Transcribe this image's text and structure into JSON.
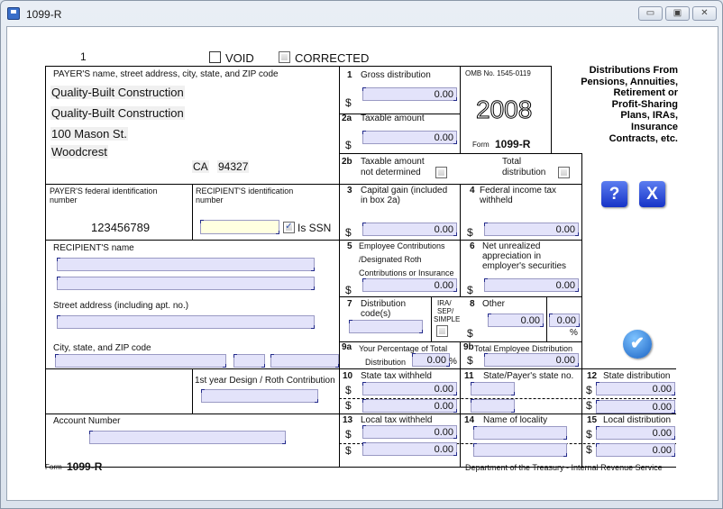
{
  "window": {
    "title": "1099-R",
    "min_label": "▭",
    "max_label": "▣",
    "close_label": "✕"
  },
  "form": {
    "sequence": "1",
    "void_label": "VOID",
    "corrected_label": "CORRECTED",
    "payer": {
      "label": "PAYER'S name, street address, city, state, and ZIP code",
      "name1": "Quality-Built Construction",
      "name2": "Quality-Built Construction",
      "street": "100 Mason St.",
      "city": "Woodcrest",
      "state": "CA",
      "zip": "94327"
    },
    "payer_fed_id": {
      "label1": "PAYER'S federal identification",
      "label2": "number",
      "value": "123456789"
    },
    "recipient_id": {
      "label1": "RECIPIENT'S identification",
      "label2": "number",
      "value": "",
      "is_ssn_label": "Is SSN",
      "is_ssn": true
    },
    "recipient": {
      "name_label": "RECIPIENT'S   name",
      "name1": "",
      "name2": "",
      "street_label": "Street address (including apt. no.)",
      "street": "",
      "city_label": "City, state, and ZIP code",
      "city": "",
      "state": "",
      "zip": ""
    },
    "first_year": {
      "label": "1st year Design / Roth Contribution",
      "value": ""
    },
    "account": {
      "label": "Account Number",
      "value": ""
    },
    "omb": "OMB No. 1545-0119",
    "year": "2008",
    "form_prefix": "Form",
    "form_name": "1099-R",
    "heading": [
      "Distributions From",
      "Pensions, Annuities,",
      "Retirement or",
      "Profit-Sharing",
      "Plans, IRAs,",
      "Insurance",
      "Contracts, etc."
    ],
    "box1": {
      "num": "1",
      "label": "Gross distribution",
      "value": "0.00"
    },
    "box2a": {
      "num": "2a",
      "label": "Taxable amount",
      "value": "0.00"
    },
    "box2b": {
      "num": "2b",
      "label1": "Taxable amount",
      "label2": "not determined",
      "total_label1": "Total",
      "total_label2": "distribution"
    },
    "box3": {
      "num": "3",
      "label1": "Capital gain (included",
      "label2": "in box 2a)",
      "value": "0.00"
    },
    "box4": {
      "num": "4",
      "label1": "Federal income tax",
      "label2": "withheld",
      "value": "0.00"
    },
    "box5": {
      "num": "5",
      "label1": "Employee Contributions",
      "label2": "/Designated Roth",
      "label3": "Contributions or Insurance",
      "value": "0.00"
    },
    "box6": {
      "num": "6",
      "label1": "Net unrealized",
      "label2": "appreciation in",
      "label3": "employer's securities",
      "value": "0.00"
    },
    "box7": {
      "num": "7",
      "label1": "Distribution",
      "label2": "code(s)",
      "value": "",
      "ira1": "IRA/",
      "ira2": "SEP/",
      "ira3": "SIMPLE"
    },
    "box8": {
      "num": "8",
      "label": "Other",
      "value": "0.00",
      "pct_value": "0.00",
      "pct_sign": "%"
    },
    "box9a": {
      "num": "9a",
      "label1": "Your Percentage of Total",
      "label2": "Distribution",
      "value": "0.00",
      "pct_sign": "%"
    },
    "box9b": {
      "num": "9b",
      "label": "Total Employee Distribution",
      "value": "0.00"
    },
    "box10": {
      "num": "10",
      "label": "State tax withheld",
      "value1": "0.00",
      "value2": "0.00"
    },
    "box11": {
      "num": "11",
      "label": "State/Payer's state no.",
      "value1": "",
      "value2": ""
    },
    "box12": {
      "num": "12",
      "label": "State distribution",
      "value1": "0.00",
      "value2": "0.00"
    },
    "box13": {
      "num": "13",
      "label": "Local tax withheld",
      "value1": "0.00",
      "value2": "0.00"
    },
    "box14": {
      "num": "14",
      "label": "Name of locality",
      "value1": "",
      "value2": ""
    },
    "box15": {
      "num": "15",
      "label": "Local distribution",
      "value1": "0.00",
      "value2": "0.00"
    },
    "dollar": "$",
    "footer_form": "Form",
    "footer_name": "1099-R",
    "footer_dept": "Department of the Treasury - Internal Revenue Service"
  },
  "buttons": {
    "help": "?",
    "close": "X",
    "ok": "✔"
  }
}
